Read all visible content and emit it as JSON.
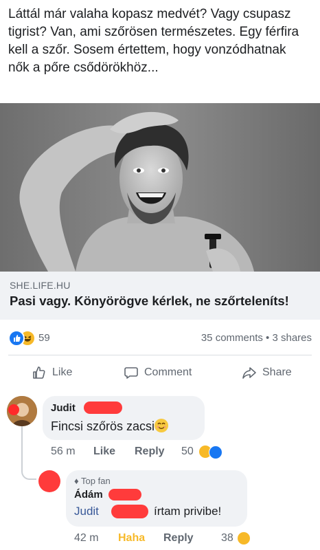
{
  "post": {
    "text": "Láttál már valaha kopasz medvét? Vagy csupasz tigrist? Van, ami szőrösen természetes. Egy férfira kell a szőr. Sosem értettem, hogy vonzódhatnak nők a pőre csődörökhöz..."
  },
  "link": {
    "domain": "SHE.LIFE.HU",
    "title": "Pasi vagy. Könyörögve kérlek, ne szőrteleníts!"
  },
  "stats": {
    "reaction_count": "59",
    "comments_shares": "35 comments • 3 shares",
    "reaction_icons": [
      "like-icon",
      "haha-icon"
    ]
  },
  "actions": {
    "like": "Like",
    "comment": "Comment",
    "share": "Share"
  },
  "comments": [
    {
      "name": "Judit",
      "text": "Fincsi szőrös zacsi",
      "time": "56 m",
      "like_label": "Like",
      "reply_label": "Reply",
      "reaction_count": "50"
    }
  ],
  "reply": {
    "badge": "Top fan",
    "name": "Ádám",
    "mention": "Judit",
    "text": "írtam privibe!",
    "time": "42 m",
    "reaction_label": "Haha",
    "reply_label": "Reply",
    "reaction_count": "38"
  },
  "colors": {
    "link_blue": "#385898",
    "haha_yellow": "#f7b928",
    "like_blue": "#1877f2",
    "redaction_red": "#ff3b3b"
  }
}
